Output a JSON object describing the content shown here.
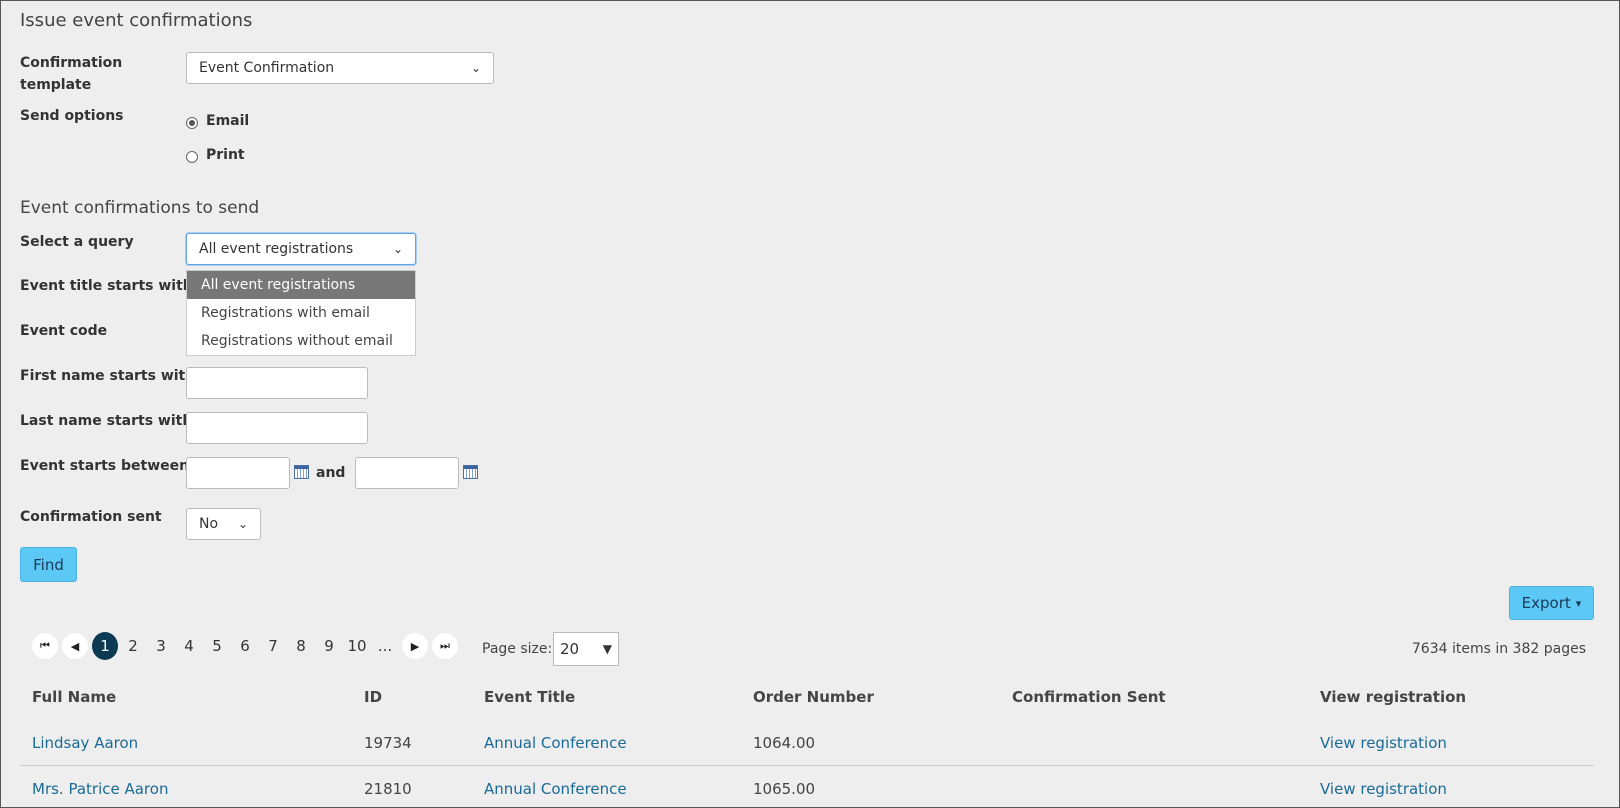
{
  "form": {
    "title": "Issue event confirmations",
    "template_label": "Confirmation template",
    "template_value": "Event Confirmation",
    "send_options_label": "Send options",
    "send_options": [
      {
        "label": "Email",
        "checked": true
      },
      {
        "label": "Print",
        "checked": false
      }
    ]
  },
  "filters": {
    "title": "Event confirmations to send",
    "query_label": "Select a query",
    "query_value": "All event registrations",
    "query_options": [
      {
        "label": "All event registrations",
        "selected": true
      },
      {
        "label": "Registrations with email",
        "selected": false
      },
      {
        "label": "Registrations without email",
        "selected": false
      }
    ],
    "event_title_label": "Event title starts with",
    "event_code_label": "Event code",
    "first_name_label": "First name starts with",
    "last_name_label": "Last name starts with",
    "event_starts_label": "Event starts between",
    "and_label": "and",
    "confirmation_sent_label": "Confirmation sent",
    "confirmation_sent_value": "No",
    "find_label": "Find"
  },
  "toolbar": {
    "export_label": "Export",
    "caret": "▾"
  },
  "pager": {
    "pages": [
      "1",
      "2",
      "3",
      "4",
      "5",
      "6",
      "7",
      "8",
      "9",
      "10",
      "..."
    ],
    "active_page": "1",
    "page_size_label": "Page size:",
    "page_size_value": "20",
    "summary": "7634 items in 382 pages"
  },
  "table": {
    "columns": [
      "Full Name",
      "ID",
      "Event Title",
      "Order Number",
      "Confirmation Sent",
      "View registration"
    ],
    "rows": [
      {
        "name": "Lindsay Aaron",
        "id": "19734",
        "event": "Annual Conference",
        "order": "1064.00",
        "sent": "",
        "view": "View registration"
      },
      {
        "name": "Mrs. Patrice Aaron",
        "id": "21810",
        "event": "Annual Conference",
        "order": "1065.00",
        "sent": "",
        "view": "View registration"
      }
    ]
  }
}
